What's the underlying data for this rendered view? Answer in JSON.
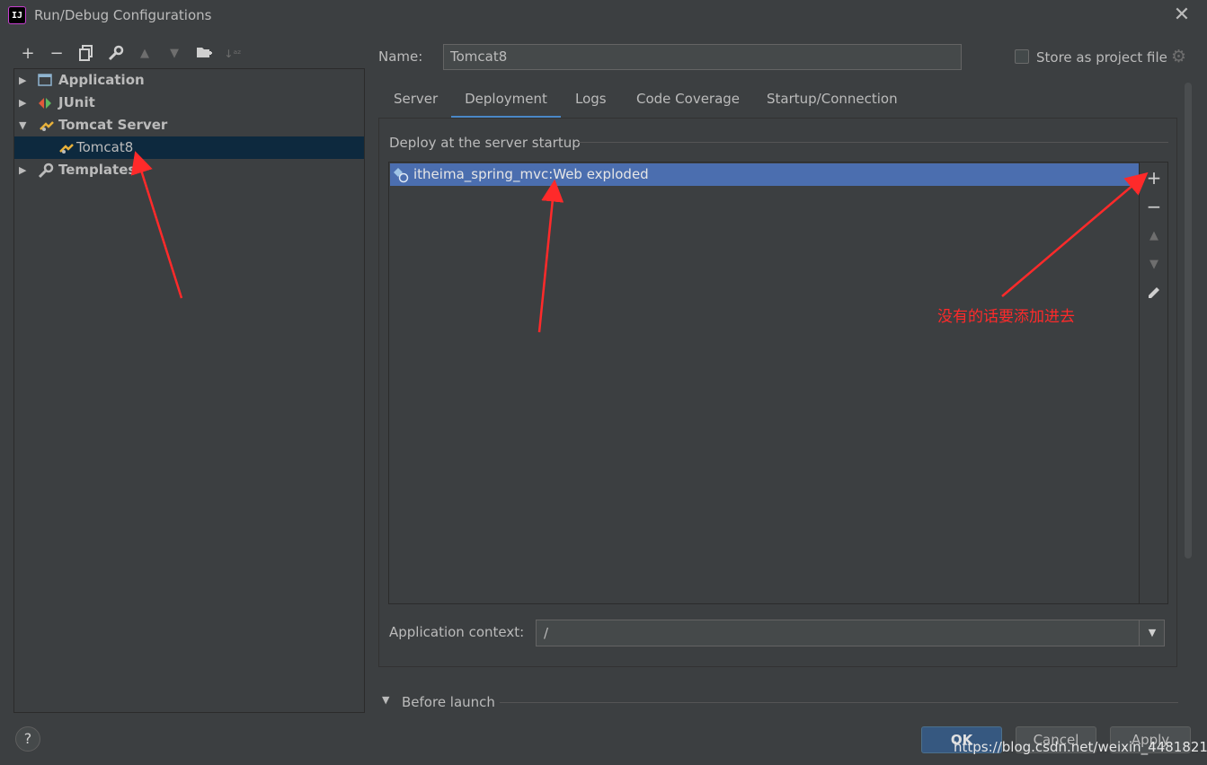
{
  "window": {
    "title": "Run/Debug Configurations",
    "app_icon_text": "IJ"
  },
  "toolbar": [
    "add-icon",
    "remove-icon",
    "copy-icon",
    "wrench-icon",
    "move-up-icon",
    "move-down-icon",
    "folder-icon",
    "sort-icon"
  ],
  "tree": {
    "items": [
      {
        "label": "Application",
        "expanded": false
      },
      {
        "label": "JUnit",
        "expanded": false
      },
      {
        "label": "Tomcat Server",
        "expanded": true
      },
      {
        "label": "Tomcat8",
        "child": true,
        "selected": true
      },
      {
        "label": "Templates",
        "expanded": false
      }
    ]
  },
  "form": {
    "name_label": "Name:",
    "name_value": "Tomcat8",
    "store_label": "Store as project file"
  },
  "tabs": [
    "Server",
    "Deployment",
    "Logs",
    "Code Coverage",
    "Startup/Connection"
  ],
  "active_tab": "Deployment",
  "deployment": {
    "section_title": "Deploy at the server startup",
    "artifacts": [
      "itheima_spring_mvc:Web exploded"
    ],
    "context_label": "Application context:",
    "context_value": "/"
  },
  "before_launch": {
    "label": "Before launch"
  },
  "buttons": {
    "help": "?",
    "ok": "OK",
    "cancel": "Cancel",
    "apply": "Apply"
  },
  "annotation": "没有的话要添加进去",
  "watermark": "https://blog.csdn.net/weixin_44818215",
  "colors": {
    "background": "#3c3f41",
    "selection": "#4b6eaf",
    "tree_selection": "#0d293e",
    "annotation": "#ff2a2a",
    "tab_underline": "#4a88c7"
  }
}
